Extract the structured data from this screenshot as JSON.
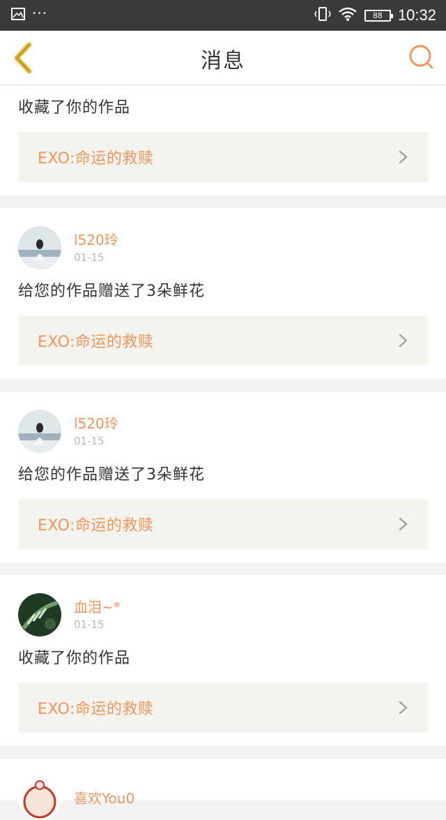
{
  "status_bar": {
    "time": "10:32",
    "battery": "88",
    "dots": "···"
  },
  "header": {
    "title": "消息"
  },
  "messages": [
    {
      "action": "收藏了你的作品",
      "work": "EXO:命运的救赎"
    },
    {
      "user": "l520玲",
      "date": "01-15",
      "action": "给您的作品赠送了3朵鲜花",
      "work": "EXO:命运的救赎",
      "avatar": "girl-avatar"
    },
    {
      "user": "l520玲",
      "date": "01-15",
      "action": "给您的作品赠送了3朵鲜花",
      "work": "EXO:命运的救赎",
      "avatar": "girl-avatar"
    },
    {
      "user": "血泪~*",
      "date": "01-15",
      "action": "收藏了你的作品",
      "work": "EXO:命运的救赎",
      "avatar": "leaf-avatar"
    },
    {
      "user": "喜欢You0",
      "avatar": "cartoon-avatar"
    }
  ],
  "colors": {
    "accent": "#f0955c",
    "back_arrow": "#e8b832",
    "work_box": "#f4f3ed"
  }
}
